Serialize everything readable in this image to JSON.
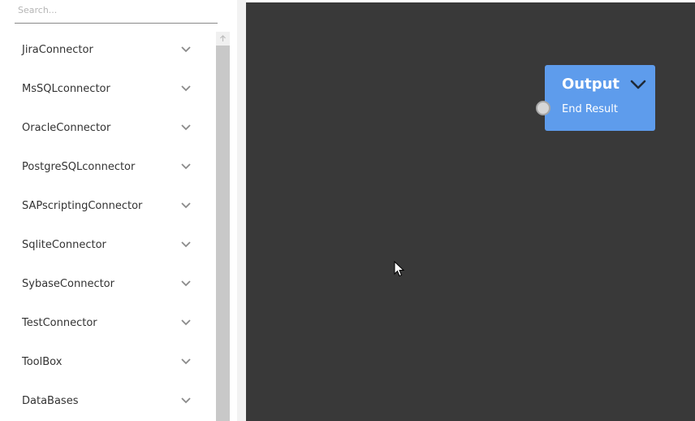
{
  "search": {
    "placeholder": "Search..."
  },
  "sidebar": {
    "items": [
      {
        "label": "JiraConnector"
      },
      {
        "label": "MsSQLconnector"
      },
      {
        "label": "OracleConnector"
      },
      {
        "label": "PostgreSQLconnector"
      },
      {
        "label": "SAPscriptingConnector"
      },
      {
        "label": "SqliteConnector"
      },
      {
        "label": "SybaseConnector"
      },
      {
        "label": "TestConnector"
      },
      {
        "label": "ToolBox"
      },
      {
        "label": "DataBases"
      }
    ],
    "item_icon": "chevron-down-icon"
  },
  "canvas": {
    "background_color": "#393939",
    "node": {
      "title": "Output",
      "port_label": "End Result",
      "color": "#5e9cec",
      "collapse_icon": "chevron-down-icon",
      "port_icon": "input-port-circle"
    }
  }
}
